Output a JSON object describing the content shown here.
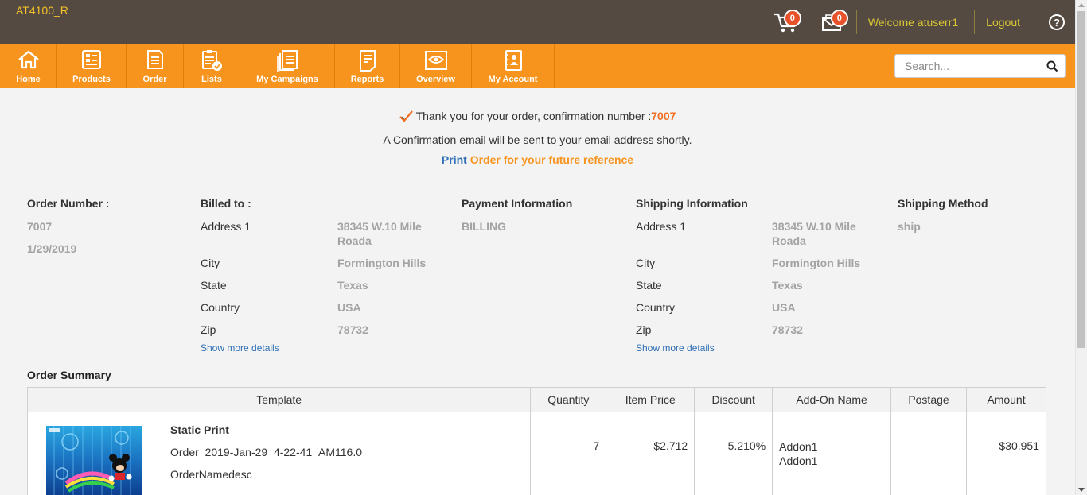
{
  "app": {
    "brand": "AT4100_R"
  },
  "header": {
    "cart_count": "0",
    "mail_count": "0",
    "welcome": "Welcome atuserr1",
    "logout": "Logout"
  },
  "nav": {
    "items": [
      {
        "label": "Home",
        "icon": "home-icon"
      },
      {
        "label": "Products",
        "icon": "products-icon"
      },
      {
        "label": "Order",
        "icon": "order-icon"
      },
      {
        "label": "Lists",
        "icon": "lists-icon"
      },
      {
        "label": "My Campaigns",
        "icon": "campaigns-icon"
      },
      {
        "label": "Reports",
        "icon": "reports-icon"
      },
      {
        "label": "Overview",
        "icon": "overview-icon"
      },
      {
        "label": "My Account",
        "icon": "account-icon"
      }
    ],
    "search_placeholder": "Search..."
  },
  "colors": {
    "topbar": "#544a42",
    "nav": "#f7941d",
    "accent": "#f26f21",
    "link": "#2e6fb5",
    "brand": "#f3c12a"
  },
  "confirmation": {
    "thanks": "Thank you for your order, confirmation number :",
    "number": "7007",
    "email_note": "A Confirmation email will be sent to your email address shortly.",
    "print_link": "Print",
    "print_rest": "Order for your future reference"
  },
  "order": {
    "number_heading": "Order Number :",
    "number": "7007",
    "date": "1/29/2019"
  },
  "billing": {
    "heading": "Billed to :",
    "labels": {
      "address": "Address 1",
      "city": "City",
      "state": "State",
      "country": "Country",
      "zip": "Zip"
    },
    "address_line1": "38345 W.10 Mile",
    "address_line2": "Roada",
    "city": "Formington Hills",
    "state": "Texas",
    "country": "USA",
    "zip": "78732",
    "more": "Show more details"
  },
  "payment": {
    "heading": "Payment Information",
    "value": "BILLING"
  },
  "shipping": {
    "heading": "Shipping Information",
    "labels": {
      "address": "Address 1",
      "city": "City",
      "state": "State",
      "country": "Country",
      "zip": "Zip"
    },
    "address_line1": "38345 W.10 Mile",
    "address_line2": "Roada",
    "city": "Formington Hills",
    "state": "Texas",
    "country": "USA",
    "zip": "78732",
    "more": "Show more details"
  },
  "shipping_method": {
    "heading": "Shipping Method",
    "value": "ship"
  },
  "summary": {
    "title": "Order Summary",
    "columns": [
      "Template",
      "Quantity",
      "Item Price",
      "Discount",
      "Add-On Name",
      "Postage",
      "Amount"
    ],
    "row": {
      "template_name": "Static Print",
      "order_name": "Order_2019-Jan-29_4-22-41_AM116.0",
      "description": "OrderNamedesc",
      "quantity": "7",
      "item_price": "$2.712",
      "discount": "5.210%",
      "addon_1": "Addon1",
      "addon_2": "Addon1",
      "postage": "",
      "amount": "$30.951"
    }
  }
}
